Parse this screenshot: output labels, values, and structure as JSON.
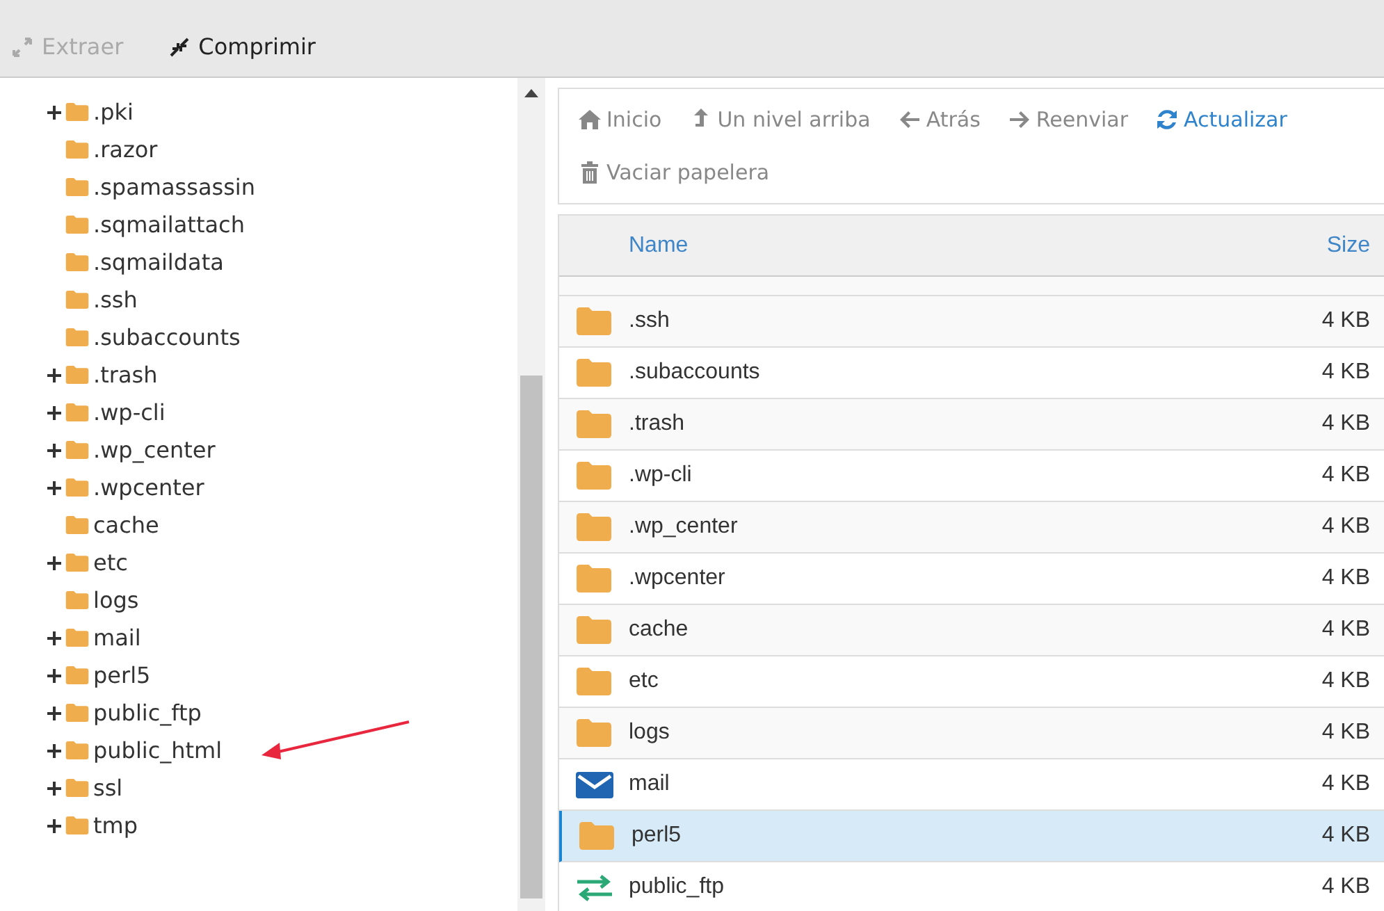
{
  "toolbar": [
    {
      "label": "Extraer",
      "kind": "extract",
      "disabled": true
    },
    {
      "label": "Comprimir",
      "kind": "compress",
      "disabled": false
    }
  ],
  "tree": [
    {
      "name": ".pki",
      "expandable": true
    },
    {
      "name": ".razor",
      "expandable": false
    },
    {
      "name": ".spamassassin",
      "expandable": false
    },
    {
      "name": ".sqmailattach",
      "expandable": false
    },
    {
      "name": ".sqmaildata",
      "expandable": false
    },
    {
      "name": ".ssh",
      "expandable": false
    },
    {
      "name": ".subaccounts",
      "expandable": false
    },
    {
      "name": ".trash",
      "expandable": true
    },
    {
      "name": ".wp-cli",
      "expandable": true
    },
    {
      "name": ".wp_center",
      "expandable": true
    },
    {
      "name": ".wpcenter",
      "expandable": true
    },
    {
      "name": "cache",
      "expandable": false
    },
    {
      "name": "etc",
      "expandable": true
    },
    {
      "name": "logs",
      "expandable": false
    },
    {
      "name": "mail",
      "expandable": true
    },
    {
      "name": "perl5",
      "expandable": true
    },
    {
      "name": "public_ftp",
      "expandable": true
    },
    {
      "name": "public_html",
      "expandable": true
    },
    {
      "name": "ssl",
      "expandable": true
    },
    {
      "name": "tmp",
      "expandable": true
    }
  ],
  "nav": [
    {
      "label": "Inicio",
      "kind": "home"
    },
    {
      "label": "Un nivel arriba",
      "kind": "up"
    },
    {
      "label": "Atrás",
      "kind": "back"
    },
    {
      "label": "Reenviar",
      "kind": "forward"
    },
    {
      "label": "Actualizar",
      "kind": "refresh"
    },
    {
      "label": "Vaciar papelera",
      "kind": "trash"
    }
  ],
  "table": {
    "columns": [
      "Name",
      "Size"
    ],
    "rows": [
      {
        "name": ".ssh",
        "size": "4 KB",
        "kind": "folder",
        "selected": false
      },
      {
        "name": ".subaccounts",
        "size": "4 KB",
        "kind": "folder",
        "selected": false
      },
      {
        "name": ".trash",
        "size": "4 KB",
        "kind": "folder",
        "selected": false
      },
      {
        "name": ".wp-cli",
        "size": "4 KB",
        "kind": "folder",
        "selected": false
      },
      {
        "name": ".wp_center",
        "size": "4 KB",
        "kind": "folder",
        "selected": false
      },
      {
        "name": ".wpcenter",
        "size": "4 KB",
        "kind": "folder",
        "selected": false
      },
      {
        "name": "cache",
        "size": "4 KB",
        "kind": "folder",
        "selected": false
      },
      {
        "name": "etc",
        "size": "4 KB",
        "kind": "folder",
        "selected": false
      },
      {
        "name": "logs",
        "size": "4 KB",
        "kind": "folder",
        "selected": false
      },
      {
        "name": "mail",
        "size": "4 KB",
        "kind": "mail",
        "selected": false
      },
      {
        "name": "perl5",
        "size": "4 KB",
        "kind": "folder",
        "selected": true
      },
      {
        "name": "public_ftp",
        "size": "4 KB",
        "kind": "ftp",
        "selected": false
      }
    ]
  }
}
